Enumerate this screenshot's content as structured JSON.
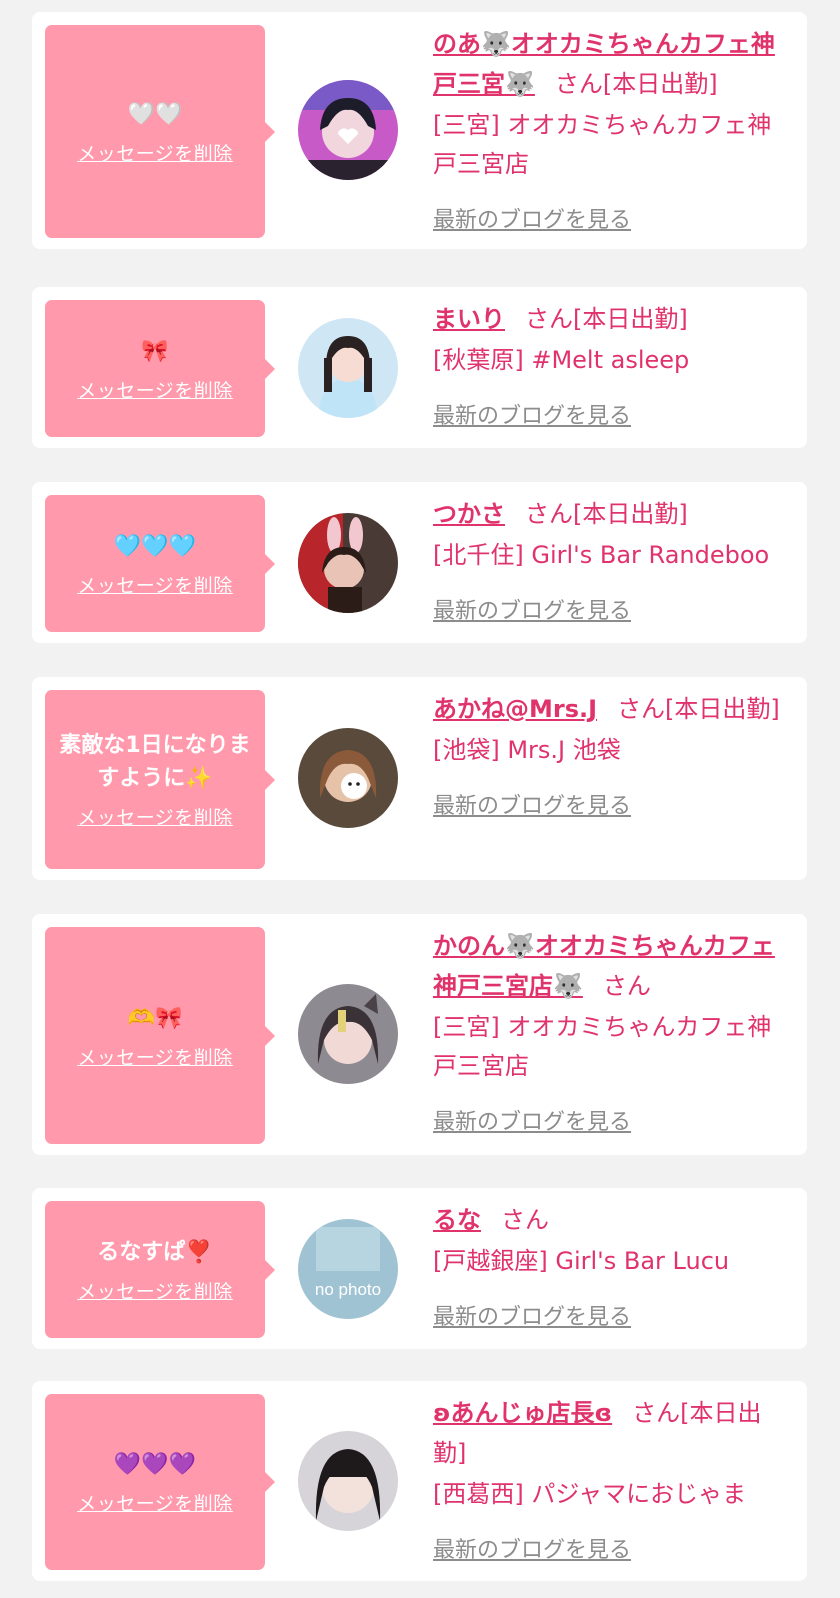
{
  "delete_label": "メッセージを削除",
  "blog_label": "最新のブログを見る",
  "colors": {
    "accent": "#e0336c",
    "message_bg": "#ff99ab",
    "card_bg": "#ffffff",
    "page_bg": "#f2f2f2",
    "link_gray": "#8c8c8c"
  },
  "items": [
    {
      "message": "🤍🤍",
      "name": "のあ🐺オオカミちゃんカフェ神戸三宮🐺",
      "suffix": "さん[本日出勤]",
      "shop": "[三宮] オオカミちゃんカフェ神戸三宮店",
      "avatar_icon": "avatar-photo-icon"
    },
    {
      "message": "🎀",
      "name": "まいり",
      "suffix": "さん[本日出勤]",
      "shop": "[秋葉原] #Melt asleep",
      "avatar_icon": "avatar-photo-icon"
    },
    {
      "message": "🩵🩵🩵",
      "name": "つかさ",
      "suffix": "さん[本日出勤]",
      "shop": "[北千住] Girl's Bar Randeboo",
      "avatar_icon": "avatar-photo-icon"
    },
    {
      "message": "素敵な1日になりますように✨",
      "name": "あかね@Mrs.J",
      "suffix": "さん[本日出勤]",
      "shop": "[池袋] Mrs.J 池袋",
      "avatar_icon": "avatar-photo-icon"
    },
    {
      "message": "🫶🎀",
      "name": "かのん🐺オオカミちゃんカフェ神戸三宮店🐺",
      "suffix": "さん",
      "shop": "[三宮] オオカミちゃんカフェ神戸三宮店",
      "avatar_icon": "avatar-photo-icon"
    },
    {
      "message": "るなすぱ❣️",
      "name": "るな",
      "suffix": "さん",
      "shop": "[戸越銀座] Girl's Bar Lucu",
      "avatar_icon": "no-photo-icon",
      "avatar_text": "no photo"
    },
    {
      "message": "💜💜💜",
      "name": "ʚあんじゅ店長ɞ",
      "suffix": "さん[本日出勤]",
      "shop": "[西葛西] パジャマにおじゃま",
      "avatar_icon": "avatar-photo-icon"
    }
  ]
}
